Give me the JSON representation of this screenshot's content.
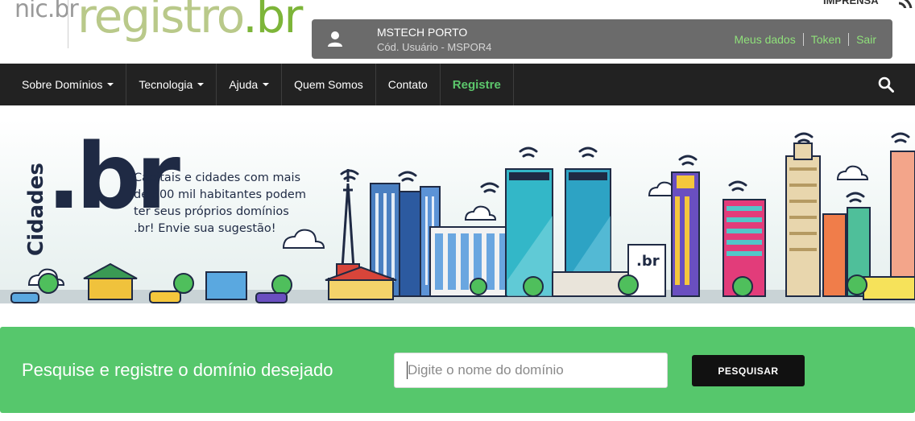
{
  "header": {
    "logo_nic": "nic.br",
    "logo_registro": "registro",
    "logo_registro_suffix": ".br",
    "imprensa": "IMPRENSA",
    "icons": [
      "rss-icon",
      "user-icon"
    ],
    "user": {
      "name": "MSTECH PORTO",
      "code": "Cód. Usuário - MSPOR4"
    },
    "links": {
      "meus_dados": "Meus dados",
      "token": "Token",
      "sair": "Sair"
    }
  },
  "nav": {
    "items": [
      {
        "label": "Sobre Domínios",
        "dropdown": true
      },
      {
        "label": "Tecnologia",
        "dropdown": true
      },
      {
        "label": "Ajuda",
        "dropdown": true
      },
      {
        "label": "Quem Somos",
        "dropdown": false
      },
      {
        "label": "Contato",
        "dropdown": false
      },
      {
        "label": "Registre",
        "dropdown": false
      }
    ],
    "search_icon": "search-icon"
  },
  "banner": {
    "cidades": "Cidades",
    "br": ".br",
    "text": "Capitais e cidades com mais de 500 mil habitantes podem ter seus próprios domínios .br! Envie sua sugestão!",
    "sign": ".br"
  },
  "search": {
    "title": "Pesquise e registre o domínio desejado",
    "placeholder": "Digite o nome do domínio",
    "button": "PESQUISAR"
  },
  "colors": {
    "navbar": "#222222",
    "green": "#56c76c",
    "link_green": "#8fe07a",
    "user_box": "#6b6b6b"
  }
}
